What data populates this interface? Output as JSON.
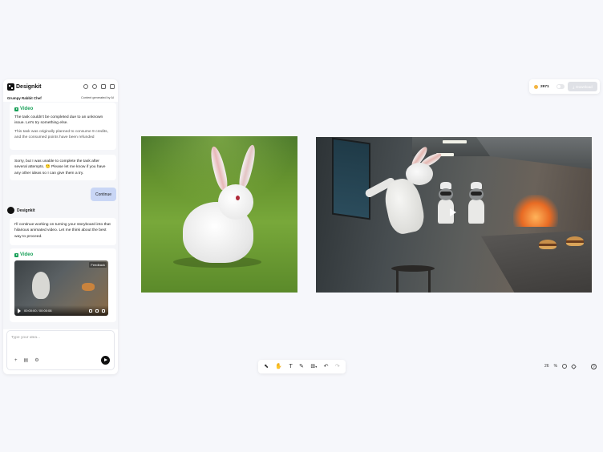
{
  "app": {
    "brand": "Designkit"
  },
  "chat": {
    "title": "Grumpy Rabbit Chef",
    "ai_note": "Content generated by AI",
    "video_tag_1": "Video",
    "error_msg_1": "The task couldn't be completed due to an unknown issue. Let's try something else.",
    "error_msg_2": "This task was originally planned to consume 9 credits, and the consumed points have been refunded",
    "sorry_msg": "Sorry, but I was unable to complete the task after several attempts. 🙁 Please let me know if you have any other ideas so I can give them a try.",
    "user_reply": "Continue",
    "sender_name": "Designkit",
    "continue_msg": "I'll continue working on turning your storyboard into that hilarious animated video. Let me think about the best way to proceed.",
    "video_tag_2": "Video",
    "video_feedback": "Feedback",
    "video_time": "00:00:00 / 00:00:08",
    "input_placeholder": "Type your idea..."
  },
  "topbar": {
    "credits": "2971",
    "download_label": "Download"
  },
  "toolbar": {
    "tools": [
      "select-icon",
      "hand-icon",
      "text-icon",
      "pen-icon",
      "shape-icon",
      "undo-icon",
      "redo-icon"
    ],
    "glyph_select": "⬉",
    "glyph_hand": "✋",
    "glyph_text": "T",
    "glyph_pen": "✎",
    "glyph_shape": "⊞",
    "glyph_dropdown": "▾",
    "glyph_undo": "↶",
    "glyph_redo": "↷"
  },
  "zoom": {
    "value": "26",
    "unit": "%"
  },
  "help_label": "?",
  "colors": {
    "accent_green": "#18a058",
    "user_bubble": "#c9d6f5",
    "coin": "#f3b542"
  }
}
